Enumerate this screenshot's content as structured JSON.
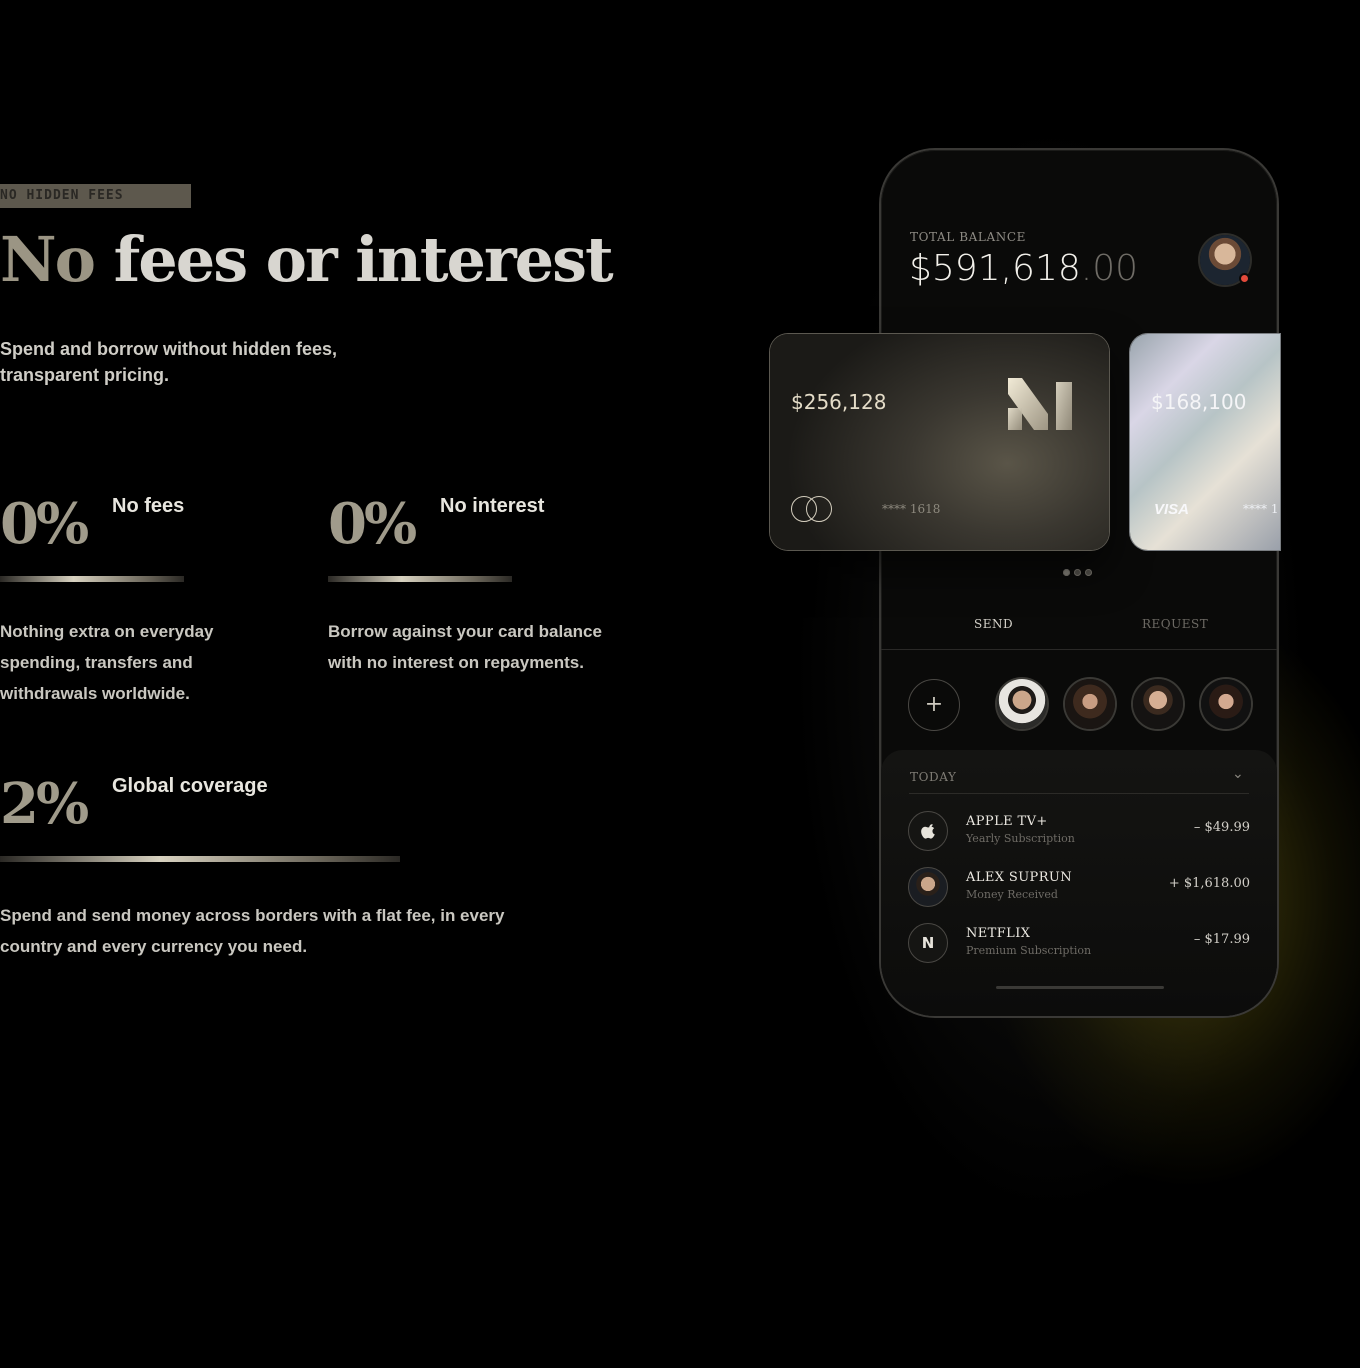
{
  "hero": {
    "eyebrow": "NO HIDDEN FEES",
    "headline_a": "No",
    "headline_b": "fees or interest",
    "lead": "Spend and borrow without hidden fees, transparent pricing."
  },
  "stats": [
    {
      "value": "0%",
      "caption": "No fees",
      "description": "Nothing extra on everyday spending, transfers and withdrawals worldwide."
    },
    {
      "value": "0%",
      "caption": "No interest",
      "description": "Borrow against your card balance with no interest on repayments."
    },
    {
      "value": "2%",
      "caption": "Global coverage",
      "description": "Spend and send money across borders with a flat fee, in every country and every currency you need."
    }
  ],
  "balance": {
    "label": "TOTAL BALANCE",
    "whole": "$591,618",
    "cents": ".00"
  },
  "cards": [
    {
      "amount": "$256,128",
      "number": "**** 1618",
      "network": "mastercard-icon"
    },
    {
      "amount": "$168,100",
      "number": "**** 1",
      "network": "VISA"
    }
  ],
  "carousel": {
    "count": 3,
    "active": 0
  },
  "tabs": {
    "send": "SEND",
    "request": "REQUEST"
  },
  "add_icon": "+",
  "today": {
    "label": "TODAY",
    "chevron": "⌄"
  },
  "transactions": [
    {
      "name": "APPLE TV+",
      "subtitle": "Yearly Subscription",
      "amount": "– $49.99",
      "icon": ""
    },
    {
      "name": "ALEX SUPRUN",
      "subtitle": "Money Received",
      "amount": "+ $1,618.00",
      "icon": ""
    },
    {
      "name": "NETFLIX",
      "subtitle": "Premium Subscription",
      "amount": "– $17.99",
      "icon": "N"
    }
  ],
  "colors": {
    "accent": "#a09b8b",
    "background": "#000000",
    "glow": "#6e6412"
  }
}
